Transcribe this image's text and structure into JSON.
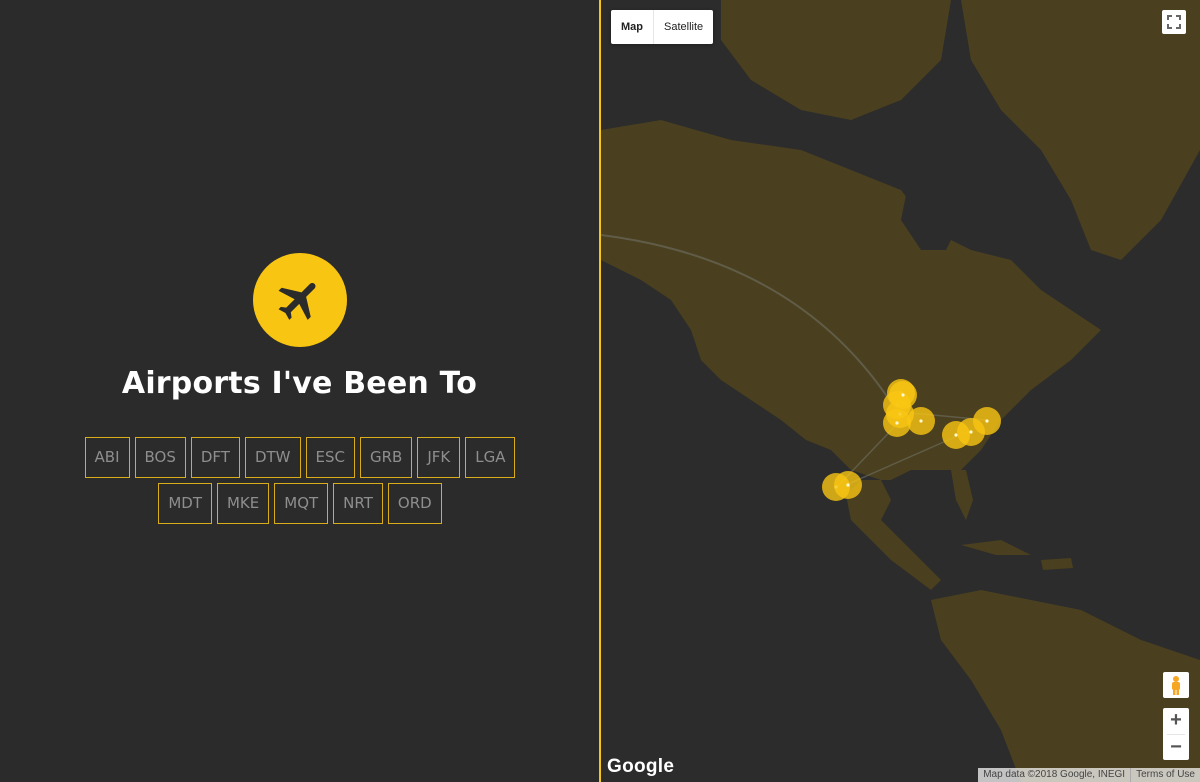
{
  "page": {
    "title": "Airports I've Been To"
  },
  "airports": [
    "ABI",
    "BOS",
    "DFT",
    "DTW",
    "ESC",
    "GRB",
    "JFK",
    "LGA",
    "MDT",
    "MKE",
    "MQT",
    "NRT",
    "ORD"
  ],
  "map": {
    "type_buttons": {
      "map": "Map",
      "satellite": "Satellite"
    },
    "attribution": "Map data ©2018 Google, INEGI",
    "terms": "Terms of Use",
    "google_logo": "Google",
    "zoom_in": "+",
    "zoom_out": "−"
  },
  "colors": {
    "accent": "#f9c513",
    "background": "#2b2b2b",
    "land": "#4a3f1e",
    "water": "#2c2c2c"
  },
  "icons": [
    "airplane-icon",
    "fullscreen-icon",
    "pegman-icon"
  ]
}
